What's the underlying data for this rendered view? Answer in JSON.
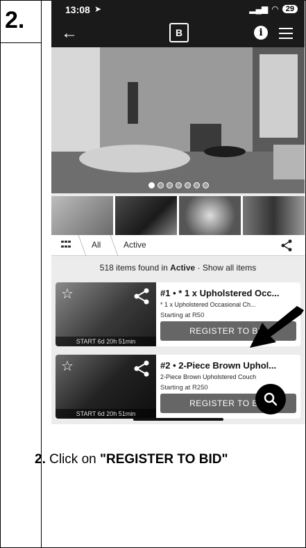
{
  "step": {
    "number": "2."
  },
  "status_bar": {
    "time": "13:08",
    "battery": "29"
  },
  "app_bar": {
    "logo_letter": "B"
  },
  "filters": {
    "tabs": [
      {
        "label": "All"
      },
      {
        "label": "Active"
      }
    ]
  },
  "results": {
    "prefix": "518 items found in ",
    "state": "Active",
    "suffix": " · Show all items"
  },
  "lots": [
    {
      "title": "#1 • * 1 x Upholstered Occ...",
      "subtitle": "* 1 x Upholstered Occasional Ch...",
      "price": "Starting at R50",
      "countdown": "START 6d 20h 51min",
      "button_label": "REGISTER TO BID"
    },
    {
      "title": "#2 • 2-Piece Brown Uphol...",
      "subtitle": "2-Piece Brown Upholstered Couch",
      "price": "Starting at R250",
      "countdown": "START 6d 20h 51min",
      "button_label": "REGISTER TO BID"
    }
  ],
  "instruction": {
    "number": "2.",
    "text": " Click on ",
    "target": "\"REGISTER TO BID\""
  },
  "icons": {
    "back": "arrow-left-icon",
    "info": "info-icon",
    "menu": "hamburger-menu-icon",
    "grid": "grid-view-icon",
    "share": "share-icon",
    "favorite": "star-icon",
    "search": "search-icon"
  },
  "colors": {
    "button": "#666666",
    "topbar": "#1a1a1a"
  }
}
